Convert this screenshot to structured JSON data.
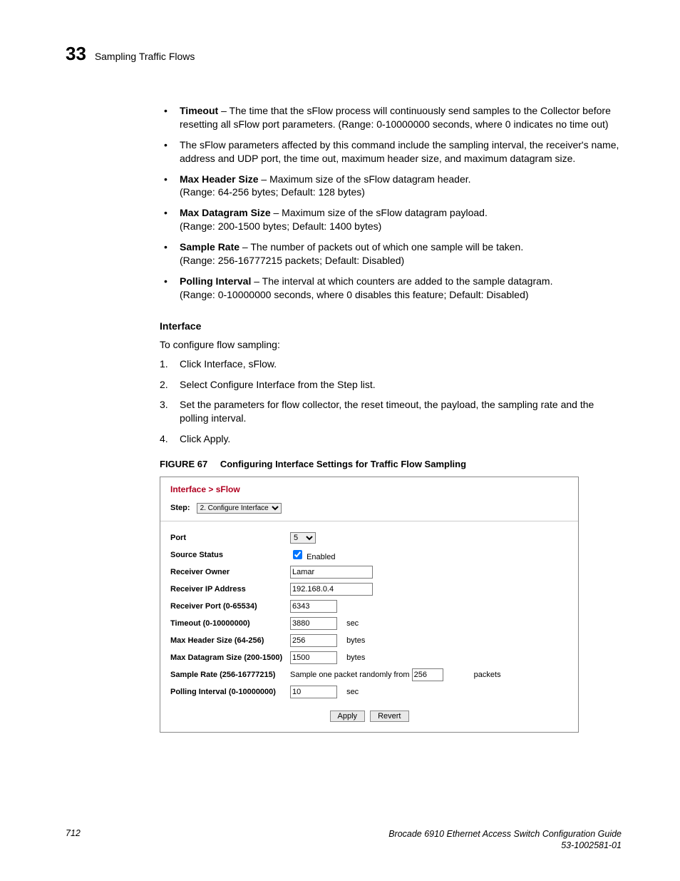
{
  "header": {
    "chapter": "33",
    "section": "Sampling Traffic Flows"
  },
  "bullets": {
    "timeout_label": "Timeout",
    "timeout_text": " – The time that the sFlow process will continuously send samples to the Collector before resetting all sFlow port parameters. (Range: 0-10000000 seconds, where 0 indicates no time out)",
    "sflow_params": "The sFlow parameters affected by this command include the sampling interval, the receiver's name, address and UDP port, the time out, maximum header size, and maximum datagram size.",
    "max_header_label": "Max Header Size",
    "max_header_text": " – Maximum size of the sFlow datagram header.",
    "max_header_range": "(Range: 64-256 bytes; Default: 128 bytes)",
    "max_datagram_label": "Max Datagram Size",
    "max_datagram_text": " – Maximum size of the sFlow datagram payload.",
    "max_datagram_range": "(Range: 200-1500 bytes; Default: 1400 bytes)",
    "sample_rate_label": "Sample Rate",
    "sample_rate_text": " – The number of packets out of which one sample will be taken.",
    "sample_rate_range": "(Range: 256-16777215 packets; Default: Disabled)",
    "polling_label": "Polling Interval",
    "polling_text": " – The interval at which counters are added to the sample datagram.",
    "polling_range": "(Range: 0-10000000 seconds, where 0 disables this feature; Default: Disabled)"
  },
  "interface": {
    "heading": "Interface",
    "intro": "To configure flow sampling:",
    "steps": [
      "Click Interface, sFlow.",
      "Select Configure Interface from the Step list.",
      "Set the parameters for flow collector, the reset timeout, the payload, the sampling rate and the polling interval.",
      "Click Apply."
    ]
  },
  "figure": {
    "label": "FIGURE 67",
    "title": "Configuring Interface Settings for Traffic Flow Sampling"
  },
  "screenshot": {
    "breadcrumb": "Interface > sFlow",
    "step_label": "Step:",
    "step_select": "2. Configure Interface",
    "rows": {
      "port": {
        "label": "Port",
        "value": "5"
      },
      "source_status": {
        "label": "Source Status",
        "checked": true,
        "text": "Enabled"
      },
      "receiver_owner": {
        "label": "Receiver Owner",
        "value": "Lamar"
      },
      "receiver_ip": {
        "label": "Receiver IP Address",
        "value": "192.168.0.4"
      },
      "receiver_port": {
        "label": "Receiver Port (0-65534)",
        "value": "6343"
      },
      "timeout": {
        "label": "Timeout (0-10000000)",
        "value": "3880",
        "unit": "sec"
      },
      "max_header": {
        "label": "Max Header Size (64-256)",
        "value": "256",
        "unit": "bytes"
      },
      "max_datagram": {
        "label": "Max Datagram Size (200-1500)",
        "value": "1500",
        "unit": "bytes"
      },
      "sample_rate": {
        "label": "Sample Rate (256-16777215)",
        "prefix": "Sample one packet randomly from",
        "value": "256",
        "unit": "packets"
      },
      "polling": {
        "label": "Polling Interval (0-10000000)",
        "value": "10",
        "unit": "sec"
      }
    },
    "buttons": {
      "apply": "Apply",
      "revert": "Revert"
    }
  },
  "footer": {
    "page": "712",
    "guide": "Brocade 6910 Ethernet Access Switch Configuration Guide",
    "docnum": "53-1002581-01"
  }
}
